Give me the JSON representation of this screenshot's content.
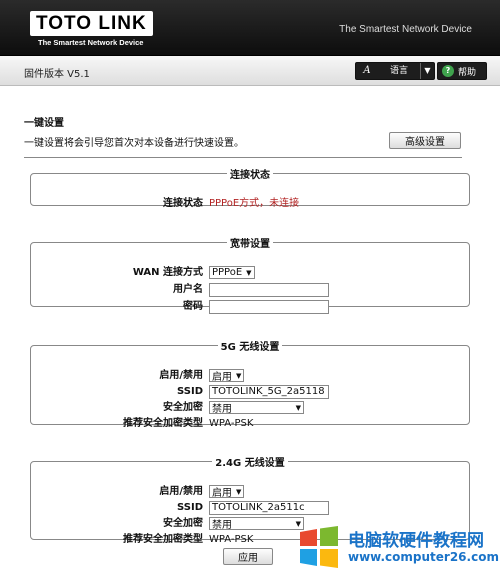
{
  "header": {
    "logo_text": "TOTO LINK",
    "logo_sub": "The Smartest Network Device",
    "tagline": "The Smartest Network Device"
  },
  "toolbar": {
    "version": "固件版本 V5.1",
    "language_icon": "A",
    "language_label": "语言",
    "help_label": "帮助"
  },
  "main": {
    "title": "一键设置",
    "description": "一键设置将会引导您首次对本设备进行快速设置。",
    "advanced_button": "高级设置"
  },
  "status_section": {
    "legend": "连接状态",
    "label": "连接状态",
    "value": "PPPoE方式，未连接"
  },
  "broadband_section": {
    "legend": "宽带设置",
    "wan_label": "WAN 连接方式",
    "wan_value": "PPPoE",
    "username_label": "用户名",
    "username_value": "",
    "password_label": "密码",
    "password_value": ""
  },
  "wifi5g_section": {
    "legend": "5G 无线设置",
    "enable_label": "启用/禁用",
    "enable_value": "启用",
    "ssid_label": "SSID",
    "ssid_value": "TOTOLINK_5G_2a5118",
    "security_label": "安全加密",
    "security_value": "禁用",
    "recommend_label": "推荐安全加密类型",
    "recommend_value": "WPA-PSK"
  },
  "wifi24g_section": {
    "legend": "2.4G 无线设置",
    "enable_label": "启用/禁用",
    "enable_value": "启用",
    "ssid_label": "SSID",
    "ssid_value": "TOTOLINK_2a511c",
    "security_label": "安全加密",
    "security_value": "禁用",
    "recommend_label": "推荐安全加密类型",
    "recommend_value": "WPA-PSK"
  },
  "apply_button": "应用",
  "watermark": {
    "title": "电脑软硬件教程网",
    "url": "www.computer26.com"
  },
  "colors": {
    "status_red": "#b22222",
    "header_bg": "#111111",
    "watermark_blue": "#1a73c8"
  }
}
